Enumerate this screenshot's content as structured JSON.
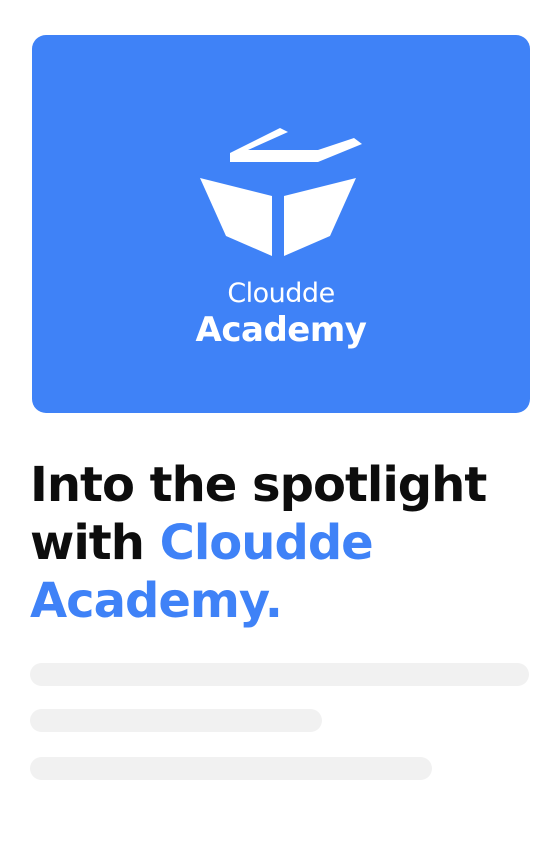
{
  "hero": {
    "background_color": "#3f82f7",
    "logo_icon": "cube-box-icon",
    "brand_line1": "Cloudde",
    "brand_line2": "Academy"
  },
  "headline": {
    "line1": "Into the spotlight",
    "line2_prefix": "with ",
    "line2_accent": "Cloudde",
    "line3_accent": "Academy."
  },
  "colors": {
    "accent": "#3f82f7",
    "text": "#0d0d0d",
    "skeleton": "#f1f1f1"
  }
}
